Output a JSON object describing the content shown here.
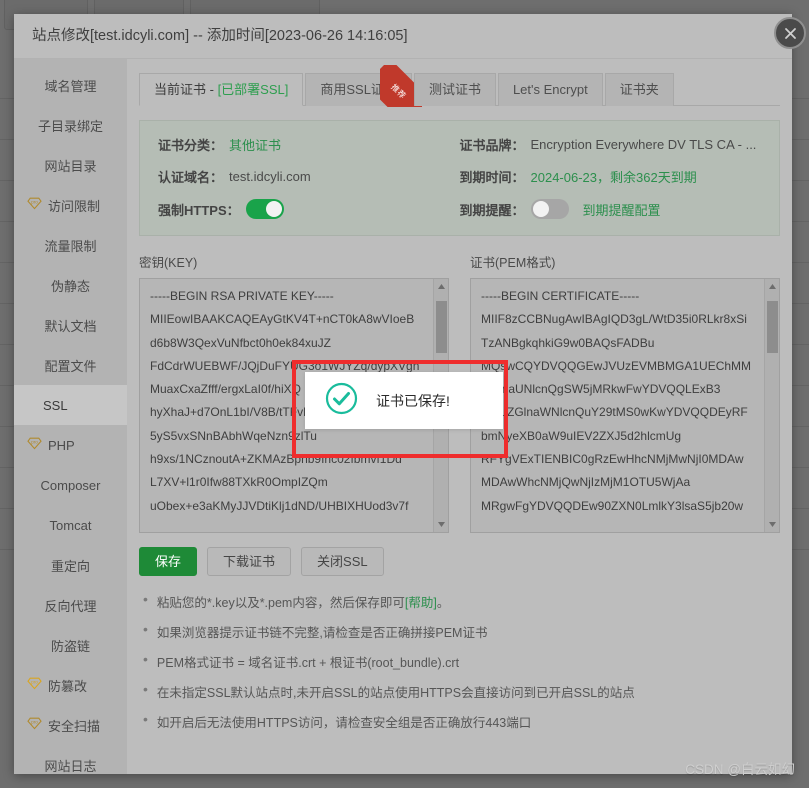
{
  "window": {
    "title": "站点修改[test.idcyli.com] -- 添加时间[2023-06-26 14:16:05]",
    "close_label": "close-icon"
  },
  "sidebar": {
    "items": [
      {
        "label": "域名管理",
        "icon": null,
        "active": false
      },
      {
        "label": "子目录绑定",
        "icon": null,
        "active": false
      },
      {
        "label": "网站目录",
        "icon": null,
        "active": false
      },
      {
        "label": "访问限制",
        "icon": "diamond-pro-icon",
        "active": false
      },
      {
        "label": "流量限制",
        "icon": null,
        "active": false
      },
      {
        "label": "伪静态",
        "icon": null,
        "active": false
      },
      {
        "label": "默认文档",
        "icon": null,
        "active": false
      },
      {
        "label": "配置文件",
        "icon": null,
        "active": false
      },
      {
        "label": "SSL",
        "icon": null,
        "active": true
      },
      {
        "label": "PHP",
        "icon": "diamond-pro-icon",
        "active": false
      },
      {
        "label": "Composer",
        "icon": null,
        "active": false
      },
      {
        "label": "Tomcat",
        "icon": null,
        "active": false
      },
      {
        "label": "重定向",
        "icon": null,
        "active": false
      },
      {
        "label": "反向代理",
        "icon": null,
        "active": false
      },
      {
        "label": "防盗链",
        "icon": null,
        "active": false
      },
      {
        "label": "防篡改",
        "icon": "diamond-pro-icon",
        "active": false
      },
      {
        "label": "安全扫描",
        "icon": "diamond-pro-icon",
        "active": false
      },
      {
        "label": "网站日志",
        "icon": null,
        "active": false
      }
    ]
  },
  "tabs": [
    {
      "label": "当前证书 - ",
      "suffix": "[已部署SSL]",
      "active": true,
      "ribbon": null
    },
    {
      "label": "商用SSL证书",
      "suffix": "",
      "active": false,
      "ribbon": "推荐"
    },
    {
      "label": "测试证书",
      "suffix": "",
      "active": false,
      "ribbon": null
    },
    {
      "label": "Let's Encrypt",
      "suffix": "",
      "active": false,
      "ribbon": null
    },
    {
      "label": "证书夹",
      "suffix": "",
      "active": false,
      "ribbon": null
    }
  ],
  "info": {
    "cert_type_label": "证书分类：",
    "cert_type_value": "其他证书",
    "domain_label": "认证域名：",
    "domain_value": "test.idcyli.com",
    "force_https_label": "强制HTTPS：",
    "force_https_on": true,
    "brand_label": "证书品牌：",
    "brand_value": "Encryption Everywhere DV TLS CA - ...",
    "expire_label": "到期时间：",
    "expire_value": "2024-06-23，剩余362天到期",
    "remind_label": "到期提醒：",
    "remind_on": false,
    "remind_config_link": "到期提醒配置"
  },
  "key_panel": {
    "label": "密钥(KEY)",
    "lines": [
      "-----BEGIN RSA PRIVATE KEY-----",
      "MIIEowIBAAKCAQEAyGtKV4T+nCT0kA8wVIoeB",
      "d6b8W3QexVuNfbct0h0ek84xuJZ",
      "FdCdrWUEBWF/JQjDuFYUG3o1WJYZq/dypXVgn",
      "MuaxCxaZfff/ergxLaI0f/hiXQ",
      "hyXhaJ+d7OnL1bI/V8B/tTFvH",
      "5yS5vxSNnBAbhWqeNzn9zlTu",
      "h9xs/1NCznoutA+ZKMAzBpnb9Ihc02fbmvf1Dd",
      "L7XV+l1r0Ifw88TXkR0OmpIZQm",
      "uObex+e3aKMyJJVDtiKlj1dND/UHBIXHUod3v7f"
    ]
  },
  "pem_panel": {
    "label": "证书(PEM格式)",
    "lines": [
      "-----BEGIN CERTIFICATE-----",
      "MIIF8zCCBNugAwIBAgIQD3gL/WtD35i0RLkr8xSi",
      "TzANBgkqhkiG9w0BAQsFADBu",
      "MQswCQYDVQQGEwJVUzEVMBMGA1UEChMM",
      "RGlnaUNlcnQgSW5jMRkwFwYDVQQLExB3",
      "d3cuZGlnaWNlcnQuY29tMS0wKwYDVQQDEyRF",
      "bmNyeXB0aW9uIEV2ZXJ5d2hlcmUg",
      "RFYgVExTIENBIC0gRzEwHhcNMjMwNjI0MDAw",
      "MDAwWhcNMjQwNjIzMjM1OTU5WjAa",
      "MRgwFgYDVQQDEw90ZXN0LmlkY3lsaS5jb20w"
    ]
  },
  "buttons": {
    "save": "保存",
    "download": "下载证书",
    "close_ssl": "关闭SSL"
  },
  "hints": [
    {
      "text": "粘贴您的*.key以及*.pem内容，然后保存即可",
      "link": "[帮助]",
      "tail": "。"
    },
    {
      "text": "如果浏览器提示证书链不完整,请检查是否正确拼接PEM证书",
      "link": "",
      "tail": ""
    },
    {
      "text": "PEM格式证书 = 域名证书.crt + 根证书(root_bundle).crt",
      "link": "",
      "tail": ""
    },
    {
      "text": "在未指定SSL默认站点时,未开启SSL的站点使用HTTPS会直接访问到已开启SSL的站点",
      "link": "",
      "tail": ""
    },
    {
      "text": "如开启后无法使用HTTPS访问，请检查安全组是否正确放行443端口",
      "link": "",
      "tail": ""
    }
  ],
  "toast": {
    "message": "证书已保存!",
    "icon": "check-circle-icon"
  },
  "watermark": "CSDN @白云如幻",
  "colors": {
    "accent_green": "#19a34a",
    "link_green": "#2c8f4d",
    "ribbon_red": "#c0392b",
    "annotation_red": "#ef2d2d",
    "toast_check": "#1abc9c"
  }
}
